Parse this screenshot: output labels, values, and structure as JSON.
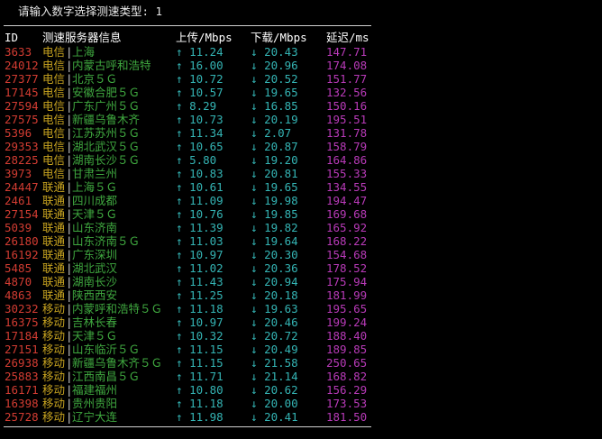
{
  "colors": {
    "background": "#000000",
    "id": "#d23c32",
    "isp": "#c8a420",
    "location": "#3fa83f",
    "speed": "#34b4b4",
    "latency": "#b83ab8",
    "header": "#ffffff",
    "rule": "#d0d0d0"
  },
  "prompt": {
    "text": "请输入数字选择测速类型: 1"
  },
  "header": {
    "id": "ID",
    "server": "测速服务器信息",
    "upload": "上传/Mbps",
    "download": "下载/Mbps",
    "latency": "延迟/ms"
  },
  "up_arrow": "↑",
  "down_arrow": "↓",
  "separator": "|",
  "rows": [
    {
      "id": "3633",
      "isp": "电信",
      "location": "上海",
      "upload": "11.24",
      "download": "20.43",
      "latency": "147.71"
    },
    {
      "id": "24012",
      "isp": "电信",
      "location": "内蒙古呼和浩特",
      "upload": "16.00",
      "download": "20.96",
      "latency": "174.08"
    },
    {
      "id": "27377",
      "isp": "电信",
      "location": "北京５Ｇ",
      "upload": "10.72",
      "download": "20.52",
      "latency": "151.77"
    },
    {
      "id": "17145",
      "isp": "电信",
      "location": "安徽合肥５Ｇ",
      "upload": "10.57",
      "download": "19.65",
      "latency": "132.56"
    },
    {
      "id": "27594",
      "isp": "电信",
      "location": "广东广州５Ｇ",
      "upload": "8.29",
      "download": "16.85",
      "latency": "150.16"
    },
    {
      "id": "27575",
      "isp": "电信",
      "location": "新疆乌鲁木齐",
      "upload": "10.73",
      "download": "20.19",
      "latency": "195.51"
    },
    {
      "id": "5396",
      "isp": "电信",
      "location": "江苏苏州５Ｇ",
      "upload": "11.34",
      "download": "2.07",
      "latency": "131.78"
    },
    {
      "id": "29353",
      "isp": "电信",
      "location": "湖北武汉５Ｇ",
      "upload": "10.65",
      "download": "20.87",
      "latency": "158.79"
    },
    {
      "id": "28225",
      "isp": "电信",
      "location": "湖南长沙５Ｇ",
      "upload": "5.80",
      "download": "19.20",
      "latency": "164.86"
    },
    {
      "id": "3973",
      "isp": "电信",
      "location": "甘肃兰州",
      "upload": "10.83",
      "download": "20.81",
      "latency": "155.33"
    },
    {
      "id": "24447",
      "isp": "联通",
      "location": "上海５Ｇ",
      "upload": "10.61",
      "download": "19.65",
      "latency": "134.55"
    },
    {
      "id": "2461",
      "isp": "联通",
      "location": "四川成都",
      "upload": "11.09",
      "download": "19.98",
      "latency": "194.47"
    },
    {
      "id": "27154",
      "isp": "联通",
      "location": "天津５Ｇ",
      "upload": "10.76",
      "download": "19.85",
      "latency": "169.68"
    },
    {
      "id": "5039",
      "isp": "联通",
      "location": "山东济南",
      "upload": "11.39",
      "download": "19.82",
      "latency": "165.92"
    },
    {
      "id": "26180",
      "isp": "联通",
      "location": "山东济南５Ｇ",
      "upload": "11.03",
      "download": "19.64",
      "latency": "168.22"
    },
    {
      "id": "16192",
      "isp": "联通",
      "location": "广东深圳",
      "upload": "10.97",
      "download": "20.30",
      "latency": "154.68"
    },
    {
      "id": "5485",
      "isp": "联通",
      "location": "湖北武汉",
      "upload": "11.02",
      "download": "20.36",
      "latency": "178.52"
    },
    {
      "id": "4870",
      "isp": "联通",
      "location": "湖南长沙",
      "upload": "11.43",
      "download": "20.94",
      "latency": "175.94"
    },
    {
      "id": "4863",
      "isp": "联通",
      "location": "陕西西安",
      "upload": "11.25",
      "download": "20.18",
      "latency": "181.99"
    },
    {
      "id": "30232",
      "isp": "移动",
      "location": "内蒙呼和浩特５Ｇ",
      "upload": "11.18",
      "download": "19.63",
      "latency": "195.65"
    },
    {
      "id": "16375",
      "isp": "移动",
      "location": "吉林长春",
      "upload": "10.97",
      "download": "20.46",
      "latency": "199.24"
    },
    {
      "id": "17184",
      "isp": "移动",
      "location": "天津５Ｇ",
      "upload": "10.32",
      "download": "20.72",
      "latency": "188.40"
    },
    {
      "id": "27151",
      "isp": "移动",
      "location": "山东临沂５Ｇ",
      "upload": "11.15",
      "download": "20.49",
      "latency": "189.85"
    },
    {
      "id": "26938",
      "isp": "移动",
      "location": "新疆乌鲁木齐５Ｇ",
      "upload": "11.15",
      "download": "21.58",
      "latency": "250.65"
    },
    {
      "id": "25883",
      "isp": "移动",
      "location": "江西南昌５Ｇ",
      "upload": "11.71",
      "download": "21.14",
      "latency": "168.82"
    },
    {
      "id": "16171",
      "isp": "移动",
      "location": "福建福州",
      "upload": "10.80",
      "download": "20.62",
      "latency": "156.29"
    },
    {
      "id": "16398",
      "isp": "移动",
      "location": "贵州贵阳",
      "upload": "11.18",
      "download": "20.00",
      "latency": "173.53"
    },
    {
      "id": "25728",
      "isp": "移动",
      "location": "辽宁大连",
      "upload": "11.98",
      "download": "20.41",
      "latency": "181.50"
    }
  ]
}
